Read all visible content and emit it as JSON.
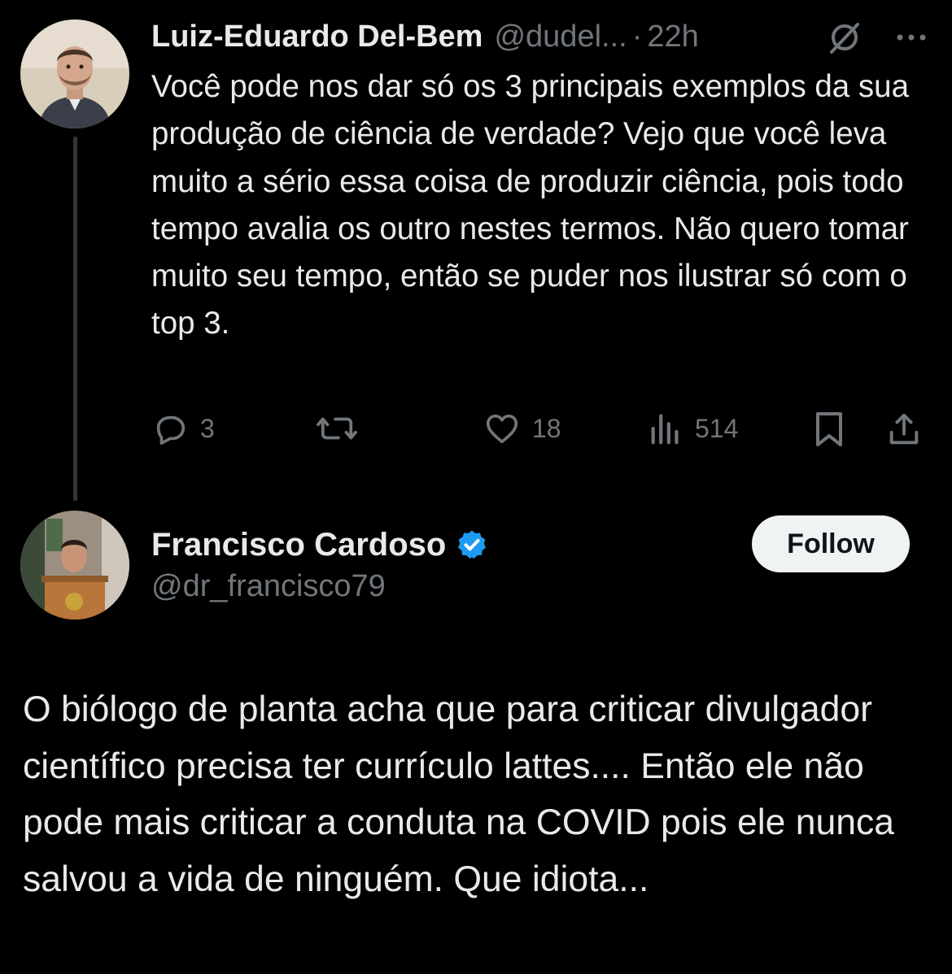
{
  "reply_tweet": {
    "author_name": "Luiz-Eduardo Del-Bem",
    "author_handle": "@dudel...",
    "separator": "·",
    "time": "22h",
    "text": "Você pode nos dar só os 3 principais exemplos da sua produção de ciência de verdade? Vejo que você leva muito a sério essa coisa de produzir ciência, pois todo tempo avalia os outro nestes termos. Não quero tomar muito seu tempo, então se puder nos ilustrar só com o top 3.",
    "actions": {
      "replies": "3",
      "likes": "18",
      "views": "514"
    },
    "icons": [
      "grok-icon",
      "more-icon",
      "reply-icon",
      "retweet-icon",
      "like-icon",
      "views-icon",
      "bookmark-icon",
      "share-icon"
    ]
  },
  "main_tweet": {
    "author_name": "Francisco Cardoso",
    "author_handle": "@dr_francisco79",
    "verified": true,
    "follow_label": "Follow",
    "text": "O biólogo de planta acha que para criticar divulgador científico precisa ter currículo lattes.... Então ele não pode mais criticar a conduta na COVID pois ele nunca salvou a vida de ninguém. Que idiota..."
  },
  "colors": {
    "background": "#000000",
    "text": "#e7e9ea",
    "muted": "#71767b",
    "verified": "#1d9bf0",
    "thread_line": "#333639"
  }
}
